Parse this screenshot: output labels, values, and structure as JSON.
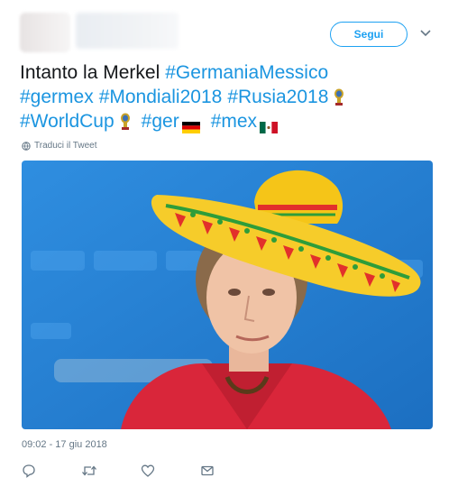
{
  "header": {
    "follow_label": "Segui",
    "avatar": "blurred-avatar",
    "username": "blurred-username",
    "more_icon": "chevron-down-icon"
  },
  "tweet": {
    "text_plain": "Intanto la Merkel",
    "hashtags": {
      "germaniamessico": "#GermaniaMessico",
      "germex": "#germex",
      "mondiali2018": "#Mondiali2018",
      "rusia2018": "#Rusia2018",
      "worldcup": "#WorldCup",
      "ger": "#ger",
      "mex": "#mex"
    },
    "emojis": [
      "trophy-emoji",
      "trophy-emoji",
      "germany-flag-emoji",
      "mexico-flag-emoji"
    ],
    "translate_label": "Traduci il Tweet",
    "translate_icon": "globe-icon"
  },
  "media": {
    "description_icon": "photo",
    "colors": {
      "background": "#2a86d6",
      "jacket": "#d9263a",
      "sombrero": "#f5c518"
    }
  },
  "meta": {
    "timestamp": "09:02 - 17 giu 2018"
  },
  "actions": [
    "reply-icon",
    "retweet-icon",
    "like-icon",
    "message-icon"
  ],
  "colors": {
    "link": "#1b95e0",
    "follow": "#1da1f2",
    "secondary": "#657786"
  }
}
